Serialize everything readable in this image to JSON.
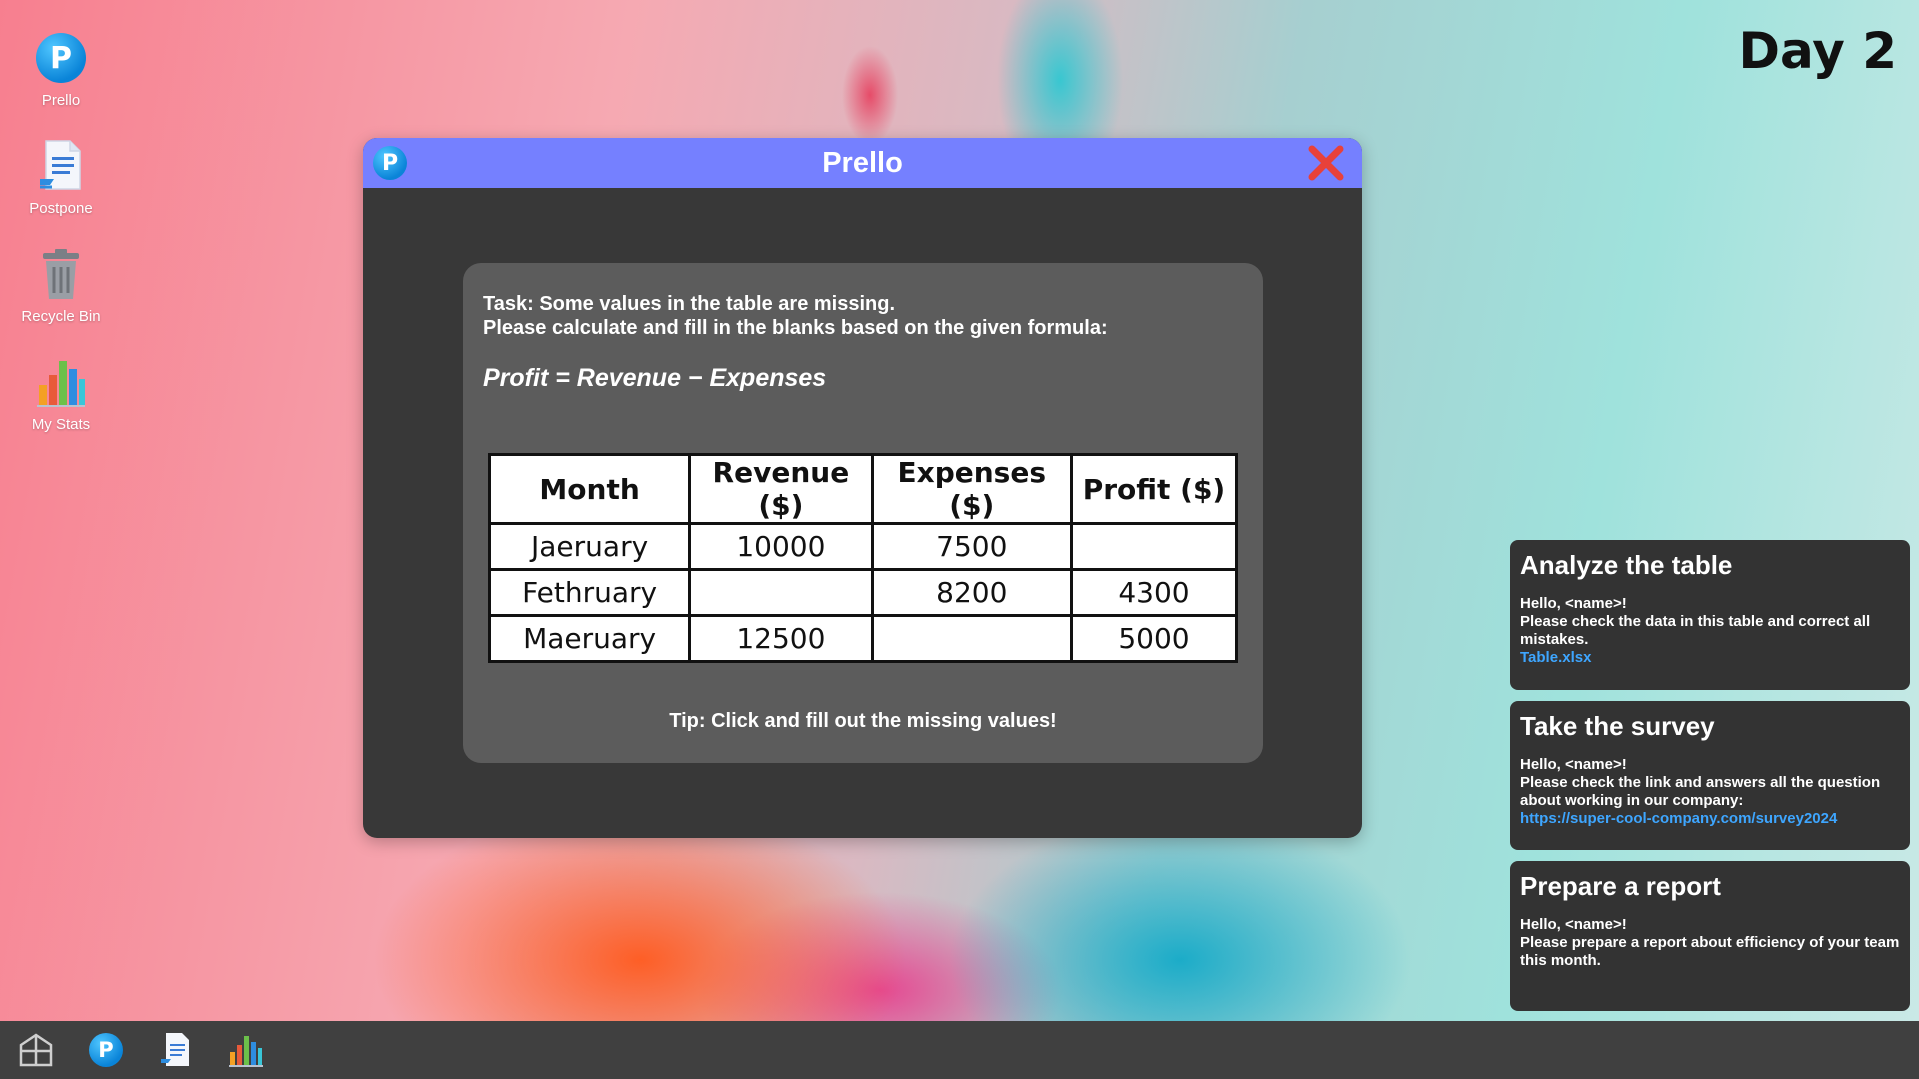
{
  "desktop": {
    "icons": [
      {
        "label": "Prello",
        "icon": "prello-logo-icon"
      },
      {
        "label": "Postpone",
        "icon": "document-icon"
      },
      {
        "label": "Recycle Bin",
        "icon": "recycle-bin-icon"
      },
      {
        "label": "My Stats",
        "icon": "bar-chart-icon"
      }
    ],
    "day_label": "Day 2"
  },
  "window": {
    "title": "Prello",
    "app_icon_letter": "P",
    "task_line1": "Task: Some values in the table are missing.",
    "task_line2": "Please calculate and fill in the blanks based on the given formula:",
    "formula": "Profit = Revenue − Expenses",
    "table": {
      "headers": [
        "Month",
        "Revenue ($)",
        "Expenses ($)",
        "Profit ($)"
      ],
      "rows": [
        [
          "Jaeruary",
          "10000",
          "7500",
          ""
        ],
        [
          "Fethruary",
          "",
          "8200",
          "4300"
        ],
        [
          "Maeruary",
          "12500",
          "",
          "5000"
        ]
      ]
    },
    "tip": "Tip: Click and fill out the missing values!"
  },
  "notifications": [
    {
      "title": "Analyze the table",
      "greeting": "Hello, <name>!",
      "body": "Please check the data in this table and correct all mistakes.",
      "link": "Table.xlsx"
    },
    {
      "title": "Take the survey",
      "greeting": "Hello, <name>!",
      "body": "Please check the link and answers all the question about working in our company:",
      "link": "https://super-cool-company.com/survey2024"
    },
    {
      "title": "Prepare a report",
      "greeting": "Hello, <name>!",
      "body": "Please prepare a report about efficiency of your team this month.",
      "link": ""
    }
  ],
  "taskbar": {
    "items": [
      "start-icon",
      "prello-logo-icon",
      "document-icon",
      "bar-chart-icon"
    ],
    "prello_letter": "P"
  },
  "colors": {
    "titlebar": "#7580ff",
    "window_bg": "#383838",
    "panel_bg": "#5c5c5c",
    "link": "#3ea6ff",
    "close": "#e8413a"
  }
}
